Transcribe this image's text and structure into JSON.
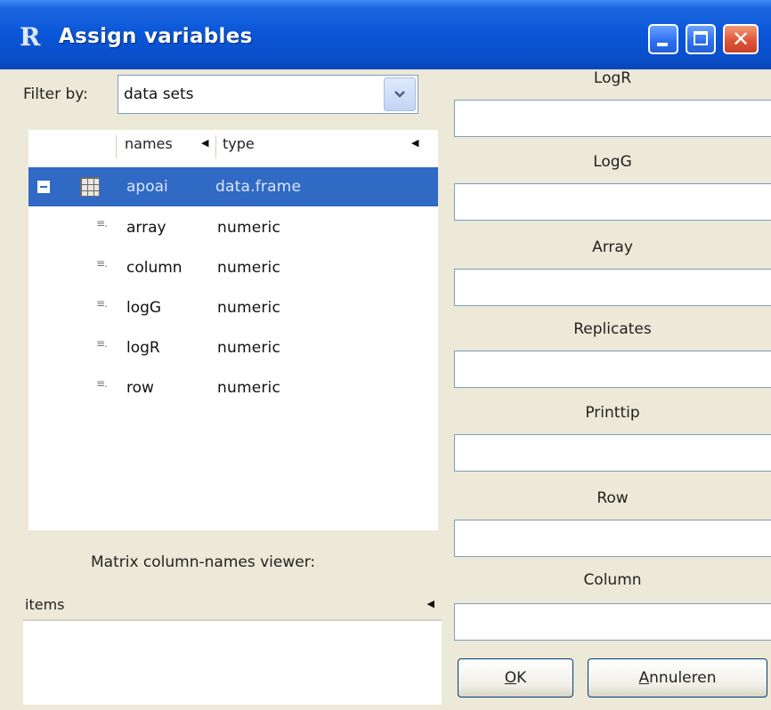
{
  "window": {
    "title": "Assign variables",
    "app_icon_letter": "R",
    "controls": [
      "minimize-icon",
      "maximize-icon",
      "close-icon"
    ]
  },
  "filter": {
    "label": "Filter by:",
    "value": "data sets"
  },
  "tree": {
    "columns": [
      "names",
      "type"
    ],
    "rows": [
      {
        "name": "apoai",
        "type": "data.frame",
        "selected": true,
        "icon": "data-frame-icon"
      },
      {
        "name": "array",
        "type": "numeric",
        "icon": "numeric-vector-icon"
      },
      {
        "name": "column",
        "type": "numeric",
        "icon": "numeric-vector-icon"
      },
      {
        "name": "logG",
        "type": "numeric",
        "icon": "numeric-vector-icon"
      },
      {
        "name": "logR",
        "type": "numeric",
        "icon": "numeric-vector-icon"
      },
      {
        "name": "row",
        "type": "numeric",
        "icon": "numeric-vector-icon"
      }
    ]
  },
  "matrix_viewer": {
    "label": "Matrix column-names viewer:",
    "column": "items"
  },
  "fields": [
    {
      "label": "LogR",
      "value": ""
    },
    {
      "label": "LogG",
      "value": ""
    },
    {
      "label": "Array",
      "value": ""
    },
    {
      "label": "Replicates",
      "value": ""
    },
    {
      "label": "Printtip",
      "value": ""
    },
    {
      "label": "Row",
      "value": ""
    },
    {
      "label": "Column",
      "value": ""
    }
  ],
  "buttons": {
    "ok_mnemonic": "O",
    "ok_rest": "K",
    "cancel_mnemonic": "A",
    "cancel_rest": "nnuleren"
  },
  "colors": {
    "titlebar": "#0a57d9",
    "selection": "#316ac5",
    "dialog_bg": "#ece9d8"
  }
}
